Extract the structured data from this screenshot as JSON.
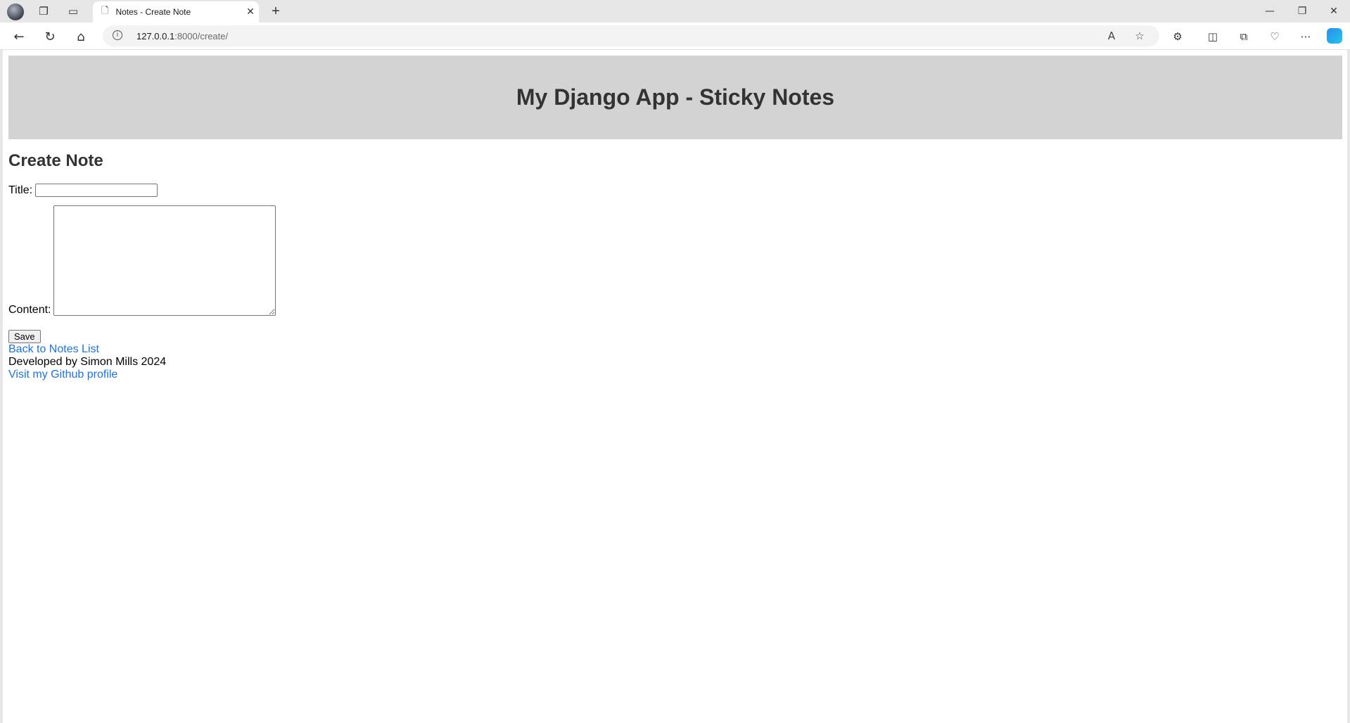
{
  "browser": {
    "tab_title": "Notes - Create Note",
    "new_tab_glyph": "+",
    "url_host": "127.0.0.1",
    "url_path": ":8000/create/",
    "icons": [
      "profile-avatar",
      "workspaces-icon",
      "tab-actions-icon",
      "page-icon",
      "close-icon",
      "new-tab-icon",
      "minimize-icon",
      "restore-icon",
      "window-close-icon",
      "back-icon",
      "refresh-icon",
      "home-icon",
      "site-info-icon",
      "read-aloud-icon",
      "favorite-star-icon",
      "extensions-icon",
      "split-screen-icon",
      "collections-icon",
      "browser-essentials-icon",
      "more-menu-icon",
      "copilot-icon"
    ]
  },
  "header": {
    "title": "My Django App - Sticky Notes",
    "background": "#d3d3d3"
  },
  "form": {
    "heading": "Create Note",
    "title_label": "Title:",
    "title_value": "",
    "content_label": "Content:",
    "content_value": "",
    "save_label": "Save"
  },
  "footer": {
    "back_link": "Back to Notes List",
    "credit": "Developed by Simon Mills 2024",
    "github_link": "Visit my Github profile",
    "link_color": "#1a73e8"
  }
}
